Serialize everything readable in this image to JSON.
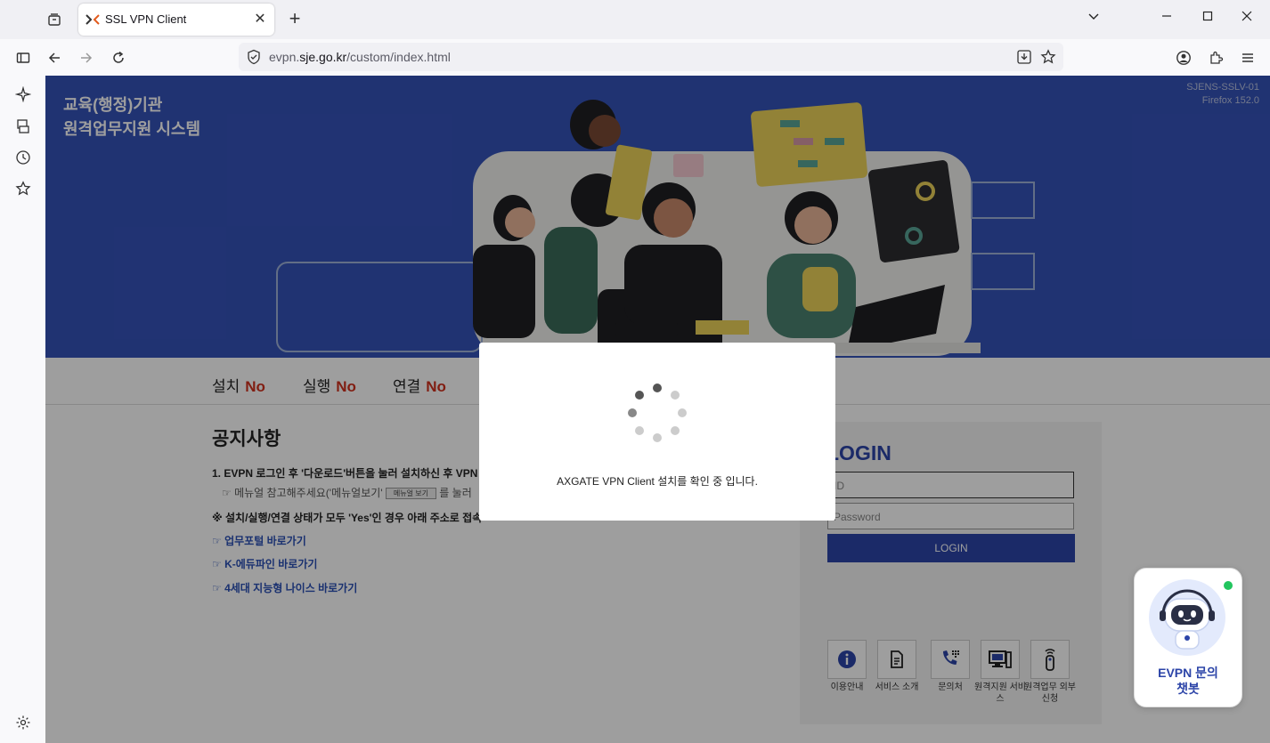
{
  "browser": {
    "tab_title": "SSL VPN Client",
    "url_domain_pre": "evpn.",
    "url_domain": "sje.go.kr",
    "url_path": "/custom/index.html"
  },
  "hero": {
    "title_line1": "교육(행정)기관",
    "title_line2": "원격업무지원 시스템",
    "info_line1": "SJENS-SSLV-01",
    "info_line2": "Firefox 152.0"
  },
  "status": {
    "install_label": "설치",
    "install_value": "No",
    "run_label": "실행",
    "run_value": "No",
    "connect_label": "연결",
    "connect_value": "No"
  },
  "notice": {
    "title": "공지사항",
    "line1": "1. EVPN 로그인 후 '다운로드'버튼을 눌러 설치하신 후 VPN",
    "line2_pre": "☞ 메뉴얼 참고해주세요('메뉴얼보기'",
    "line2_tag": "메뉴얼 보기",
    "line2_post": "를 눌러",
    "line3": "※ 설치/실행/연결 상태가 모두 'Yes'인 경우 아래 주소로 접속",
    "links": [
      "☞ 업무포털 바로가기",
      "☞ K-에듀파인 바로가기",
      "☞ 4세대 지능형 나이스 바로가기"
    ]
  },
  "login": {
    "title": "LOGIN",
    "id_placeholder": "ID",
    "pw_placeholder": "Password",
    "button": "LOGIN"
  },
  "quick_links": [
    {
      "label": "이용안내",
      "icon": "info-icon"
    },
    {
      "label": "서비스 소개",
      "icon": "document-icon"
    },
    {
      "label": "문의처",
      "icon": "phone-icon"
    },
    {
      "label": "원격지원 서비스",
      "icon": "monitor-icon"
    },
    {
      "label": "원격업무 외부신청",
      "icon": "remote-icon"
    }
  ],
  "modal": {
    "message": "AXGATE VPN Client 설치를 확인 중 입니다."
  },
  "chatbot": {
    "line1": "EVPN 문의",
    "line2": "챗봇"
  },
  "colors": {
    "hero_bg": "#3553b9",
    "accent": "#2c44a8",
    "status_no": "#d0311e",
    "online_dot": "#22c55e"
  }
}
